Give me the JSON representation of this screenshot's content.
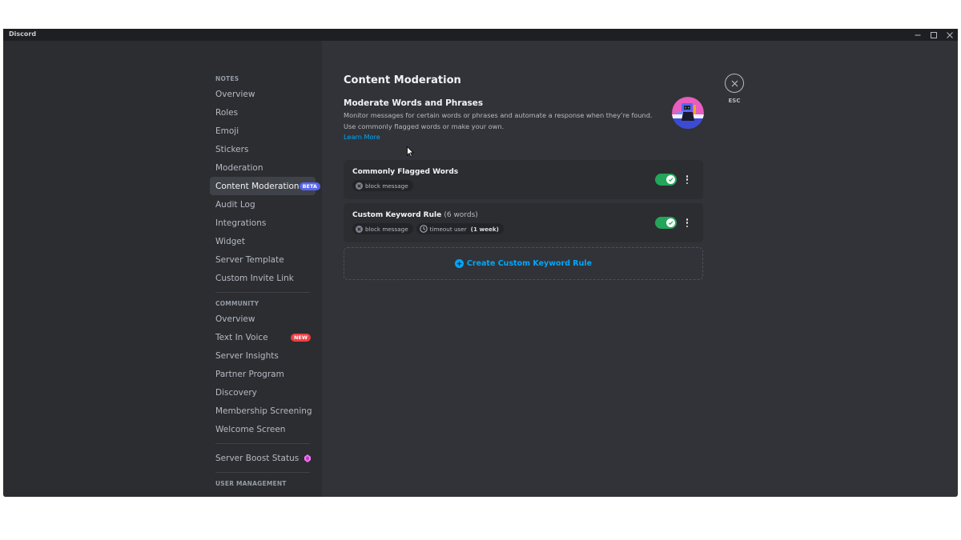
{
  "window": {
    "title": "Discord",
    "controls": {
      "minimize": "–",
      "maximize": "□",
      "close": "✕"
    }
  },
  "sidebar": {
    "sections": [
      {
        "header": "NOTES",
        "items": [
          {
            "label": "Overview"
          },
          {
            "label": "Roles"
          },
          {
            "label": "Emoji"
          },
          {
            "label": "Stickers"
          },
          {
            "label": "Moderation"
          },
          {
            "label": "Content Moderation",
            "badge": "BETA",
            "active": true
          },
          {
            "label": "Audit Log"
          },
          {
            "label": "Integrations"
          },
          {
            "label": "Widget"
          },
          {
            "label": "Server Template"
          },
          {
            "label": "Custom Invite Link"
          }
        ]
      },
      {
        "header": "COMMUNITY",
        "items": [
          {
            "label": "Overview"
          },
          {
            "label": "Text In Voice",
            "badge": "NEW"
          },
          {
            "label": "Server Insights"
          },
          {
            "label": "Partner Program"
          },
          {
            "label": "Discovery"
          },
          {
            "label": "Membership Screening"
          },
          {
            "label": "Welcome Screen"
          }
        ]
      },
      {
        "items": [
          {
            "label": "Server Boost Status",
            "icon": "boost-gem-icon"
          }
        ]
      },
      {
        "header": "USER MANAGEMENT",
        "items": []
      }
    ]
  },
  "main": {
    "title": "Content Moderation",
    "section_title": "Moderate Words and Phrases",
    "section_desc": "Monitor messages for certain words or phrases and automate a response when they’re found. Use commonly flagged words or make your own.",
    "learn_more": "Learn More",
    "esc_label": "ESC",
    "rules": [
      {
        "title": "Commonly Flagged Words",
        "subtitle": "",
        "enabled": true,
        "actions": [
          {
            "icon": "block-icon",
            "label": "block message",
            "detail": ""
          }
        ]
      },
      {
        "title": "Custom Keyword Rule",
        "subtitle": "(6 words)",
        "enabled": true,
        "actions": [
          {
            "icon": "block-icon",
            "label": "block message",
            "detail": ""
          },
          {
            "icon": "clock-icon",
            "label": "timeout user",
            "detail": "(1 week)"
          }
        ]
      }
    ],
    "create_button": "Create Custom Keyword Rule"
  },
  "colors": {
    "accent": "#5865f2",
    "link": "#00a8fc",
    "toggle_on": "#23a55a",
    "new_badge": "#f23f43",
    "boost": "#ff73fa"
  }
}
